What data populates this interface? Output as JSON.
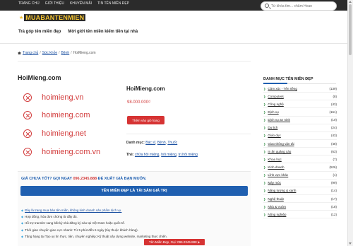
{
  "brand": {
    "name": "MUABANTENMIEN"
  },
  "topnav": {
    "items": [
      "TRANG CHỦ",
      "GIỚI THIỆU",
      "KHUYẾN MÃI",
      "TIN TÊN MIỀN ĐẸP"
    ]
  },
  "search": {
    "placeholder": "Từ khóa tìm... chăm Hoan"
  },
  "subnav": {
    "items": [
      "Trả góp tên miền đẹp",
      "Mời giới tên miền kiếm tiền tại nhà"
    ]
  },
  "breadcrumb": {
    "items": [
      "Trang chủ",
      "Sức khỏe",
      "Bệnh",
      "HoiMieng.com"
    ]
  },
  "page": {
    "title": "HoiMieng.com"
  },
  "domain_image": {
    "lines": [
      "hoimieng.vn",
      "hoimieng.com",
      "hoimieng.net",
      "hoimieng.com.vn"
    ]
  },
  "product": {
    "name": "HoiMieng.com",
    "price": "98.000.000₫",
    "cart_label": "Thêm vào giỏ hàng",
    "category_label": "Danh mục:",
    "categories": [
      "Bác sĩ",
      "Bệnh",
      "Thuốc"
    ],
    "tags_label": "Thẻ:",
    "tags": [
      "chữa hôi miệng",
      "hôi miệng",
      "trị hôi miệng"
    ]
  },
  "promo": {
    "heading_prefix": "GIÁ CHƯA TỐT? GỌI NGAY",
    "heading_phone": "096.2345.888",
    "heading_suffix": "ĐỂ XUẤT GIÁ BẠN MUỐN.",
    "button": "TÊN MIỀN ĐẸP LÀ TÀI SẢN GIÁ TRỊ",
    "items": [
      "Đây là trang mua bán tên miền, không kinh doanh sản phẩm dịch vụ.",
      "Hợp đồng, hóa đơn chứng từ đầy đủ.",
      "Hỗ trợ transfer sang bất kỳ nhà đăng ký nào tại Việt Nam hoặc quốc tế.",
      "Thời gian chuyển giao cực nhanh: Từ 5 phút đến 6 ngày (tùy thuộc khách hàng).",
      "Tăng hạng tại Tạo uy tín thực, tiện, chuyên nghiệp; Kỹ thuật xây dựng website, marketing thực chiến."
    ]
  },
  "sidebar": {
    "title": "DANH MỤC TÊN MIỀN ĐẸP",
    "items": [
      {
        "name": "Cảm xúc - Tên riêng",
        "count": "(139)"
      },
      {
        "name": "Computers",
        "count": "(8)"
      },
      {
        "name": "Công nghệ",
        "count": "(43)"
      },
      {
        "name": "Dịch vụ",
        "count": "(161)"
      },
      {
        "name": "Dịch vụ an ninh",
        "count": "(10)"
      },
      {
        "name": "Du lịch",
        "count": "(24)"
      },
      {
        "name": "Giáo dục",
        "count": "(43)"
      },
      {
        "name": "Giao thông vận tải",
        "count": "(48)"
      },
      {
        "name": "In ấn quảng cáo",
        "count": "(63)"
      },
      {
        "name": "Khoa học",
        "count": "(7)"
      },
      {
        "name": "Kinh doanh",
        "count": "(526)"
      },
      {
        "name": "Lĩnh vực khác",
        "count": "(1)"
      },
      {
        "name": "Máy móc",
        "count": "(99)"
      },
      {
        "name": "Nâng lượng & xanh",
        "count": "(14)"
      },
      {
        "name": "Nghệ thuật",
        "count": "(17)"
      },
      {
        "name": "Nhà & Vườn",
        "count": "(18)"
      },
      {
        "name": "Nông nghiệp",
        "count": "(12)"
      }
    ]
  },
  "sticky": {
    "label": "Tên Miền Đẹp, Gọi: 096.2345.888 ⮞"
  },
  "colors": {
    "accent_red": "#d63333",
    "accent_blue": "#1f5fb0",
    "topbar": "#2b2b2b"
  }
}
